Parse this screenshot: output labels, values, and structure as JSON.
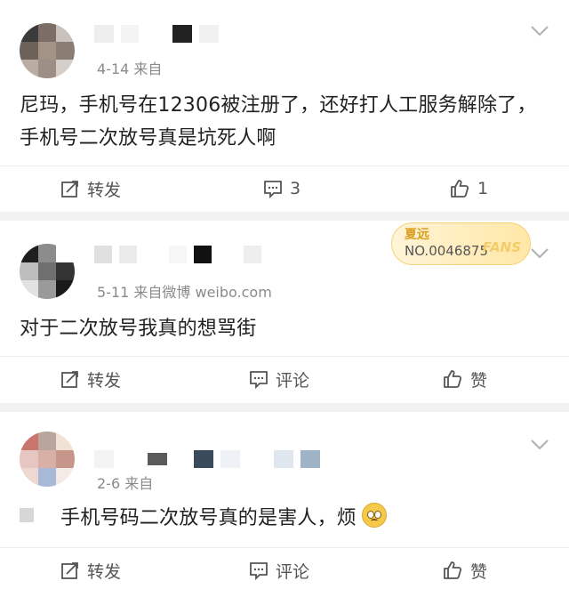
{
  "comments": [
    {
      "date_source": "4-14  来自",
      "text": "尼玛，手机号在12306被注册了，还好打人工服务解除了，手机号二次放号真是坑死人啊",
      "actions": {
        "repost": "转发",
        "comment": "3",
        "like": "1"
      }
    },
    {
      "date_source": "5-11  来自微博 weibo.com",
      "badge": {
        "line1": "夏远",
        "line2": "NO.0046875",
        "line3": "FANS"
      },
      "text": "对于二次放号我真的想骂街",
      "actions": {
        "repost": "转发",
        "comment": "评论",
        "like": "赞"
      }
    },
    {
      "date_source": "2-6  来自",
      "text": "手机号码二次放号真的是害人，烦",
      "actions": {
        "repost": "转发",
        "comment": "评论",
        "like": "赞"
      }
    }
  ]
}
